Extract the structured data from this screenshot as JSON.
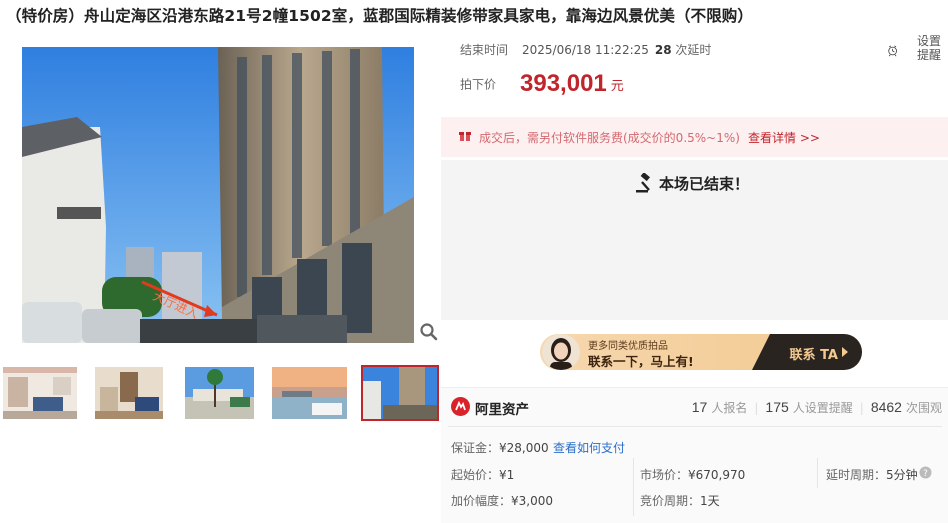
{
  "title": "（特价房）舟山定海区沿港东路21号2幢1502室，蓝郡国际精装修带家具家电，靠海边风景优美（不限购）",
  "auction": {
    "end_label": "结束时间",
    "end_time": "2025/06/18 11:22:25",
    "delay_count": "28",
    "delay_unit": "次延时",
    "remind_label": "设置提醒",
    "price_label": "拍下价",
    "price_value": "393,001",
    "price_unit": "元"
  },
  "fee_notice": {
    "text": "成交后，需另付软件服务费(成交价的0.5%~1%)",
    "link": "查看详情 >>"
  },
  "ended": {
    "text": "本场已结束！"
  },
  "contact": {
    "line1": "更多同类优质拍品",
    "line2": "联系一下，马上有!",
    "cta": "联系 TA"
  },
  "gallery": {
    "watermark": "大厅进入",
    "thumbnails": 5,
    "active_index": 5
  },
  "seller": {
    "name": "阿里资产"
  },
  "stats": {
    "signups": "17",
    "signups_label": "人报名",
    "reminders": "175",
    "reminders_label": "人设置提醒",
    "views": "8462",
    "views_label": "次围观"
  },
  "details": {
    "deposit_label": "保证金：",
    "deposit_value": "¥28,000",
    "deposit_link": "查看如何支付",
    "start_label": "起始价：",
    "start_value": "¥1",
    "market_label": "市场价：",
    "market_value": "¥670,970",
    "delay_label": "延时周期：",
    "delay_value": "5分钟",
    "increment_label": "加价幅度：",
    "increment_value": "¥3,000",
    "cycle_label": "竞价周期：",
    "cycle_value": "1天"
  },
  "colors": {
    "accent": "#c0252b",
    "link": "#2a6fc9",
    "fee_bg": "#fdf0f1"
  }
}
